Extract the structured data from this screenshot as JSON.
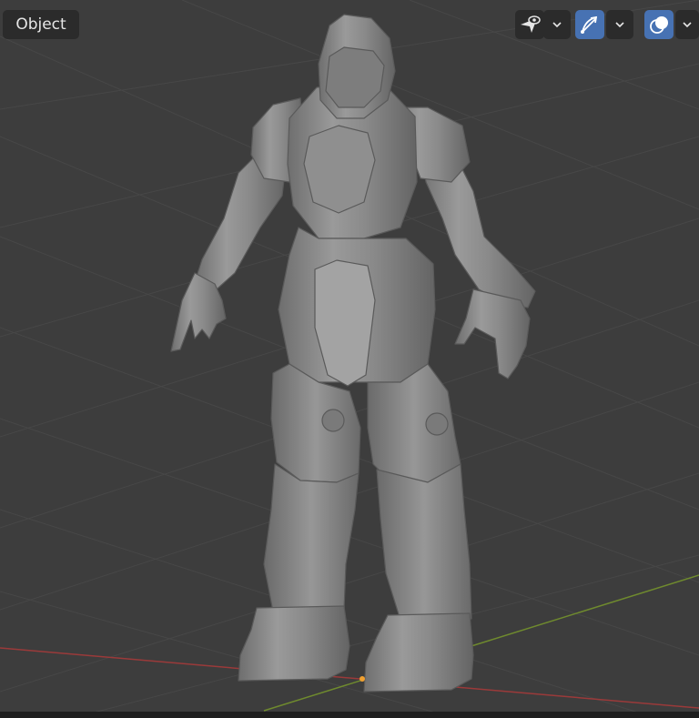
{
  "header": {
    "mode_label": "Object",
    "icons": {
      "visibility": "eye-cursor-icon",
      "gizmo": "gizmo-icon",
      "overlays": "overlays-icon",
      "dropdown": "chevron-down-icon"
    }
  },
  "viewport": {
    "grid_axes": [
      "x-axis",
      "y-axis"
    ],
    "colors": {
      "background": "#3d3d3d",
      "grid": "#474747",
      "x_axis": "#9b3a3a",
      "y_axis": "#6f8a2e",
      "model": "#8c8c8c",
      "origin": "#f0a030",
      "active_button": "#4772b3"
    }
  }
}
